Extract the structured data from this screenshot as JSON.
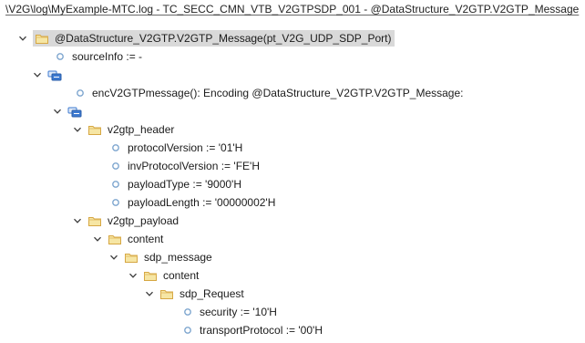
{
  "header": {
    "path": "\\V2G\\log\\MyExample-MTC.log  -  TC_SECC_CMN_VTB_V2GTPSDP_001 - @DataStructure_V2GTP.V2GTP_Message"
  },
  "tree": {
    "nodes": [
      {
        "label": "@DataStructure_V2GTP.V2GTP_Message(pt_V2G_UDP_SDP_Port)",
        "kind": "folder",
        "level": 0,
        "expanded": true,
        "selected": true
      },
      {
        "label": "sourceInfo := -",
        "kind": "leaf",
        "level": 1
      },
      {
        "label": "",
        "kind": "record",
        "level": 0,
        "expanded": true
      },
      {
        "label": "encV2GTPmessage(): Encoding @DataStructure_V2GTP.V2GTP_Message:",
        "kind": "leaf",
        "level": 2
      },
      {
        "label": "",
        "kind": "record",
        "level": 1,
        "expanded": true
      },
      {
        "label": "v2gtp_header",
        "kind": "folder",
        "level": 2,
        "expanded": true
      },
      {
        "label": "protocolVersion := '01'H",
        "kind": "leaf",
        "level": 3
      },
      {
        "label": "invProtocolVersion := 'FE'H",
        "kind": "leaf",
        "level": 3
      },
      {
        "label": "payloadType := '9000'H",
        "kind": "leaf",
        "level": 3
      },
      {
        "label": "payloadLength := '00000002'H",
        "kind": "leaf",
        "level": 3
      },
      {
        "label": "v2gtp_payload",
        "kind": "folder",
        "level": 2,
        "expanded": true
      },
      {
        "label": "content",
        "kind": "folder",
        "level": 3,
        "expanded": true
      },
      {
        "label": "sdp_message",
        "kind": "folder",
        "level": 4,
        "expanded": true
      },
      {
        "label": "content",
        "kind": "folder",
        "level": 5,
        "expanded": true
      },
      {
        "label": "sdp_Request",
        "kind": "folder",
        "level": 6,
        "expanded": true
      },
      {
        "label": "security := '10'H",
        "kind": "leaf",
        "level": 7
      },
      {
        "label": "transportProtocol := '00'H",
        "kind": "leaf",
        "level": 7
      }
    ]
  },
  "colors": {
    "folder_fill": "#f6e6a4",
    "folder_stroke": "#d6a743",
    "record_blue": "#3d7ad1",
    "leaf_dot": "#7ea6cf",
    "selected_bg": "#d9d9d9"
  },
  "icons": {
    "expanded": "chevron-down-icon",
    "folder": "folder-icon",
    "record": "record-icon",
    "leaf": "bullet-icon"
  }
}
